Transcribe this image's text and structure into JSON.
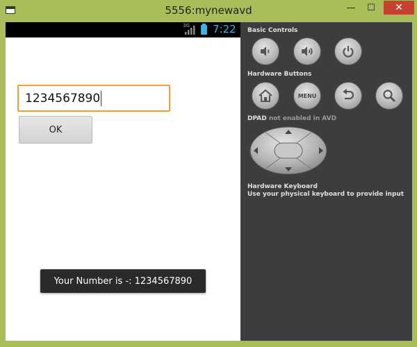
{
  "window": {
    "title": "5556:mynewavd",
    "minimize_glyph": "—",
    "maximize_glyph": "☐",
    "close_glyph": "✕"
  },
  "status_bar": {
    "network_label": "3G",
    "time": "7:22",
    "time_color": "#33b5e5"
  },
  "app": {
    "number_input_value": "1234567890",
    "ok_button_label": "OK",
    "toast_text": "Your Number is -: 1234567890",
    "input_border_color": "#f0a030"
  },
  "panel": {
    "basic_controls_title": "Basic Controls",
    "basic_controls": [
      {
        "icon": "volume-down-icon"
      },
      {
        "icon": "volume-up-icon"
      },
      {
        "icon": "power-icon"
      }
    ],
    "hardware_buttons_title": "Hardware Buttons",
    "hardware_buttons": [
      {
        "icon": "home-icon"
      },
      {
        "icon": "menu-button",
        "label": "MENU"
      },
      {
        "icon": "back-icon"
      },
      {
        "icon": "search-icon"
      }
    ],
    "dpad_title": "DPAD",
    "dpad_note": "not enabled in AVD",
    "keyboard_title": "Hardware Keyboard",
    "keyboard_note": "Use your physical keyboard to provide input"
  },
  "colors": {
    "window_frame": "#a9bd5a",
    "panel_bg": "#3d3d3d",
    "close_button": "#c7412f"
  }
}
